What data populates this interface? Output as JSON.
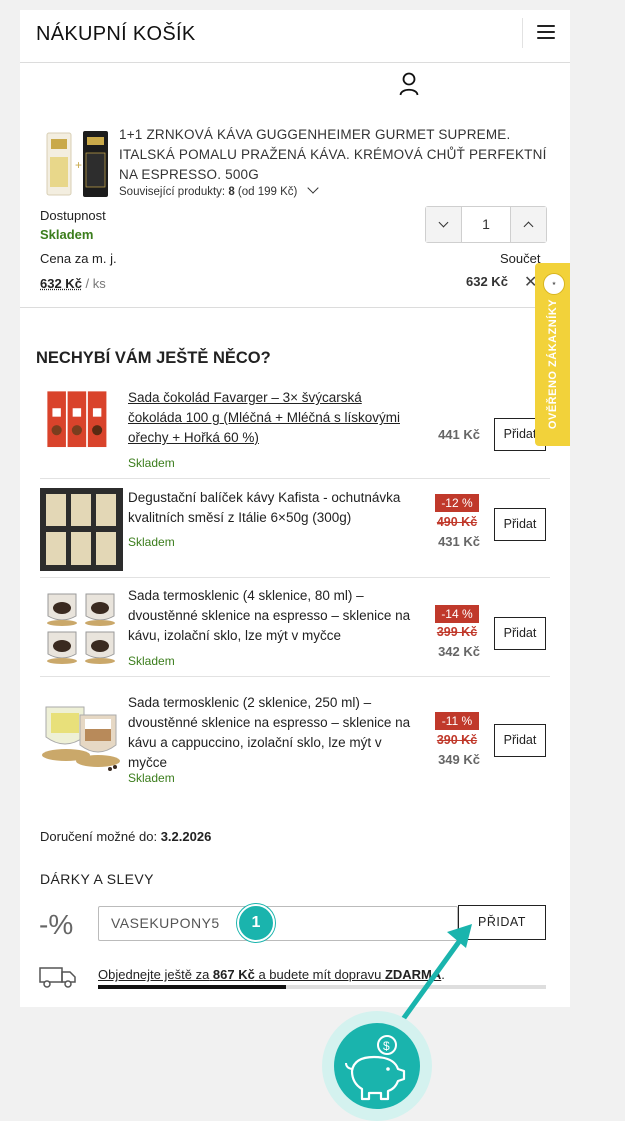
{
  "header": {
    "title": "NÁKUPNÍ KOŠÍK"
  },
  "cart_item": {
    "name": "1+1 ZRNKOVÁ KÁVA GUGGENHEIMER GURMET SUPREME. ITALSKÁ POMALU PRAŽENÁ KÁVA. KRÉMOVÁ CHŮŤ PERFEKTNÍ NA ESPRESSO. 500G",
    "related_label": "Související produkty:",
    "related_count": "8",
    "related_from": "(od 199 Kč)",
    "availability_label": "Dostupnost",
    "availability_value": "Skladem",
    "quantity": "1",
    "unit_price_label": "Cena za m. j.",
    "unit_price": "632 Kč",
    "unit_suffix": "/ ks",
    "sum_label": "Součet",
    "total": "632 Kč",
    "remove_symbol": "✕"
  },
  "recommendations": {
    "title": "NECHYBÍ VÁM JEŠTĚ NĚCO?",
    "add_label": "Přidat",
    "items": [
      {
        "name": "Sada čokolád Favarger – 3× švýcarská čokoláda 100 g (Mléčná + Mléčná s lískovými ořechy + Hořká 60 %)",
        "stock": "Skladem",
        "discount": "",
        "old_price": "",
        "price": "441 Kč"
      },
      {
        "name": "Degustační balíček kávy Kafista - ochutnávka kvalitních směsí z Itálie 6×50g (300g)",
        "stock": "Skladem",
        "discount": "-12 %",
        "old_price": "490 Kč",
        "price": "431 Kč"
      },
      {
        "name": "Sada termosklenic (4 sklenice, 80 ml) – dvoustěnné sklenice na espresso – sklenice na kávu, izolační sklo, lze mýt v myčce",
        "stock": "Skladem",
        "discount": "-14 %",
        "old_price": "399 Kč",
        "price": "342 Kč"
      },
      {
        "name": "Sada termosklenic (2 sklenice, 250 ml) – dvoustěnné sklenice na espresso – sklenice na kávu a cappuccino, izolační sklo, lze mýt v myčce",
        "stock": "Skladem",
        "discount": "-11 %",
        "old_price": "390 Kč",
        "price": "349 Kč"
      }
    ]
  },
  "delivery": {
    "label": "Doručení možné do:",
    "date": "3.2.2026"
  },
  "gifts": {
    "title": "DÁRKY A SLEVY",
    "percent_symbol": "-%",
    "coupon_value": "VASEKUPONY5",
    "button_label": "PŘIDAT"
  },
  "shipping": {
    "prefix": "Objednejte ještě za",
    "amount": "867 Kč",
    "middle": "a budete mít dopravu",
    "free": "ZDARMA",
    "suffix": ".",
    "progress": 0.42
  },
  "badge": {
    "text": "OVĚŘENO ZÁKAZNÍKY"
  },
  "annotation": {
    "step": "1"
  },
  "colors": {
    "stock_green": "#3b7d1c",
    "discount_red": "#c0392b",
    "accent_teal": "#1ab4ad",
    "ribbon_yellow": "#f2d23a"
  },
  "icons": {
    "menu": "hamburger-icon",
    "user": "user-icon",
    "truck": "truck-icon",
    "piggy": "piggy-bank-icon"
  }
}
